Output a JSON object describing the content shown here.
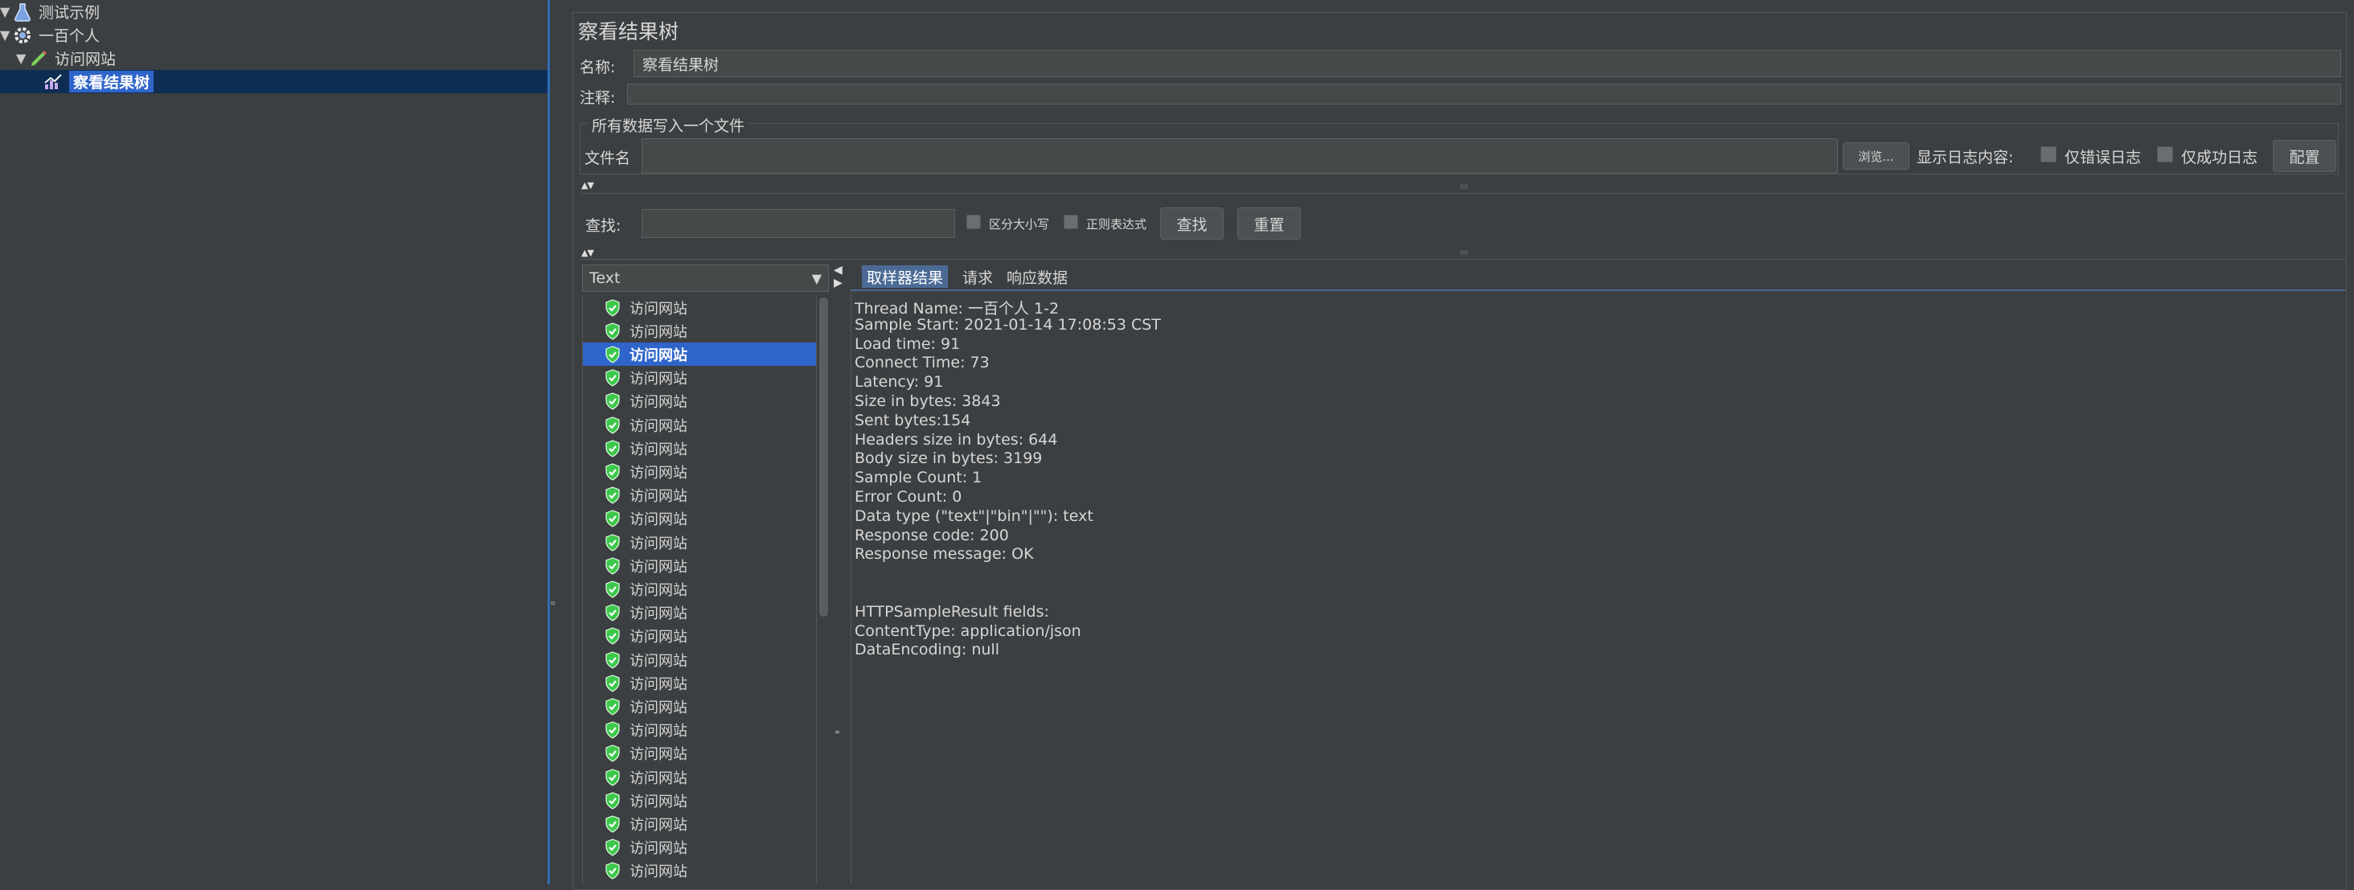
{
  "tree": {
    "nodes": [
      {
        "label": "测试示例",
        "icon": "flask-icon"
      },
      {
        "label": "一百个人",
        "icon": "gear-icon"
      },
      {
        "label": "访问网站",
        "icon": "pencil-icon"
      },
      {
        "label": "察看结果树",
        "icon": "chart-icon"
      }
    ]
  },
  "panel": {
    "title": "察看结果树",
    "name_label": "名称:",
    "name_value": "察看结果树",
    "comment_label": "注释:",
    "comment_value": ""
  },
  "file_group": {
    "legend": "所有数据写入一个文件",
    "filename_label": "文件名",
    "filename_value": "",
    "browse_label": "浏览...",
    "log_label": "显示日志内容:",
    "errors_only_label": "仅错误日志",
    "success_only_label": "仅成功日志",
    "configure_label": "配置"
  },
  "search": {
    "label": "查找:",
    "value": "",
    "case_label": "区分大小写",
    "regex_label": "正则表达式",
    "find_label": "查找",
    "reset_label": "重置"
  },
  "renderer": {
    "selected": "Text"
  },
  "results": {
    "item_label": "访问网站",
    "count": 25,
    "selected_index": 2
  },
  "tabs": [
    "取样器结果",
    "请求",
    "响应数据"
  ],
  "detail": [
    "Thread Name: 一百个人 1-2",
    "Sample Start: 2021-01-14 17:08:53 CST",
    "Load time: 91",
    "Connect Time: 73",
    "Latency: 91",
    "Size in bytes: 3843",
    "Sent bytes:154",
    "Headers size in bytes: 644",
    "Body size in bytes: 3199",
    "Sample Count: 1",
    "Error Count: 0",
    "Data type (\"text\"|\"bin\"|\"\"): text",
    "Response code: 200",
    "Response message: OK",
    "",
    "",
    "HTTPSampleResult fields:",
    "ContentType: application/json",
    "DataEncoding: null"
  ],
  "colors": {
    "background": "#3c3f41",
    "selection": "#2f65ca",
    "success_green": "#3cc84a"
  }
}
